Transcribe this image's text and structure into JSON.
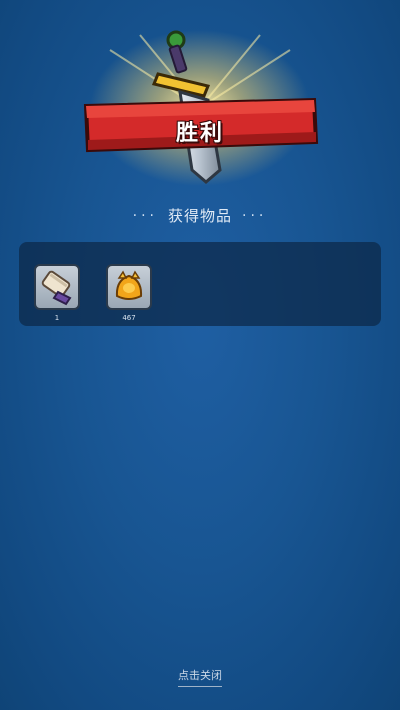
{
  "banner": {
    "title": "胜利"
  },
  "header": {
    "dots_left": "···",
    "label": "获得物品",
    "dots_right": "···"
  },
  "items": [
    {
      "icon": "scroll-icon",
      "count": "1"
    },
    {
      "icon": "gold-helmet-icon",
      "count": "467"
    }
  ],
  "footer": {
    "close_label": "点击关闭"
  },
  "colors": {
    "background": "#185592",
    "banner_red": "#d42a2a",
    "glow": "#ffd86a",
    "panel": "#0c2848"
  }
}
